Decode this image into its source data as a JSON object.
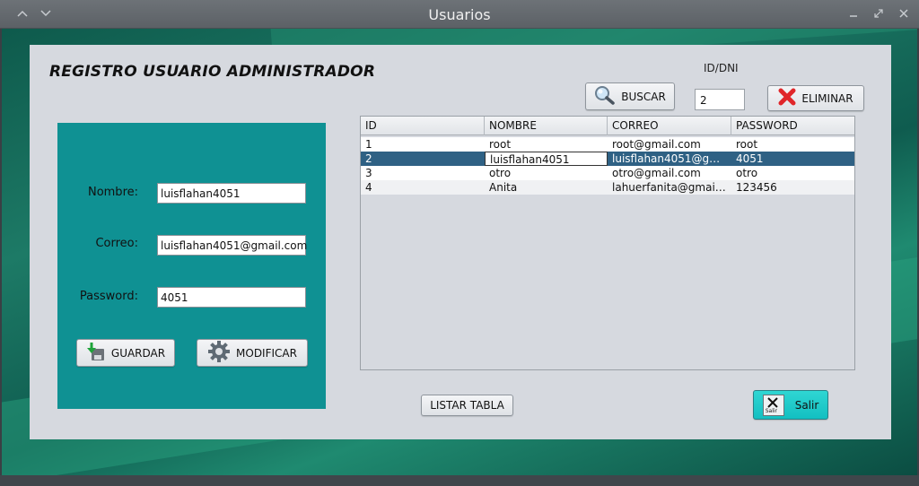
{
  "window": {
    "title": "Usuarios"
  },
  "heading": "REGISTRO USUARIO ADMINISTRADOR",
  "search": {
    "label": "ID/DNI",
    "value": "2",
    "buscar_label": "BUSCAR",
    "eliminar_label": "ELIMINAR"
  },
  "form": {
    "nombre_label": "Nombre:",
    "nombre_value": "luisflahan4051",
    "correo_label": "Correo:",
    "correo_value": "luisflahan4051@gmail.com",
    "password_label": "Password:",
    "password_value": "4051",
    "guardar_label": "GUARDAR",
    "modificar_label": "MODIFICAR"
  },
  "table": {
    "columns": [
      "ID",
      "NOMBRE",
      "CORREO",
      "PASSWORD"
    ],
    "rows": [
      {
        "id": "1",
        "nombre": "root",
        "correo": "root@gmail.com",
        "password": "root"
      },
      {
        "id": "2",
        "nombre": "luisflahan4051",
        "correo": "luisflahan4051@gma...",
        "password": "4051"
      },
      {
        "id": "3",
        "nombre": "otro",
        "correo": "otro@gmail.com",
        "password": "otro"
      },
      {
        "id": "4",
        "nombre": "Anita",
        "correo": "lahuerfanita@gmail.c...",
        "password": "123456"
      }
    ],
    "selected_row": 1
  },
  "buttons": {
    "listar_label": "LISTAR TABLA",
    "salir_label": "Salir",
    "salir_icon_text": "Salir"
  },
  "colors": {
    "form_bg": "#0f9193",
    "selection": "#2f6184",
    "salir_bg": "#1ec9c8"
  }
}
